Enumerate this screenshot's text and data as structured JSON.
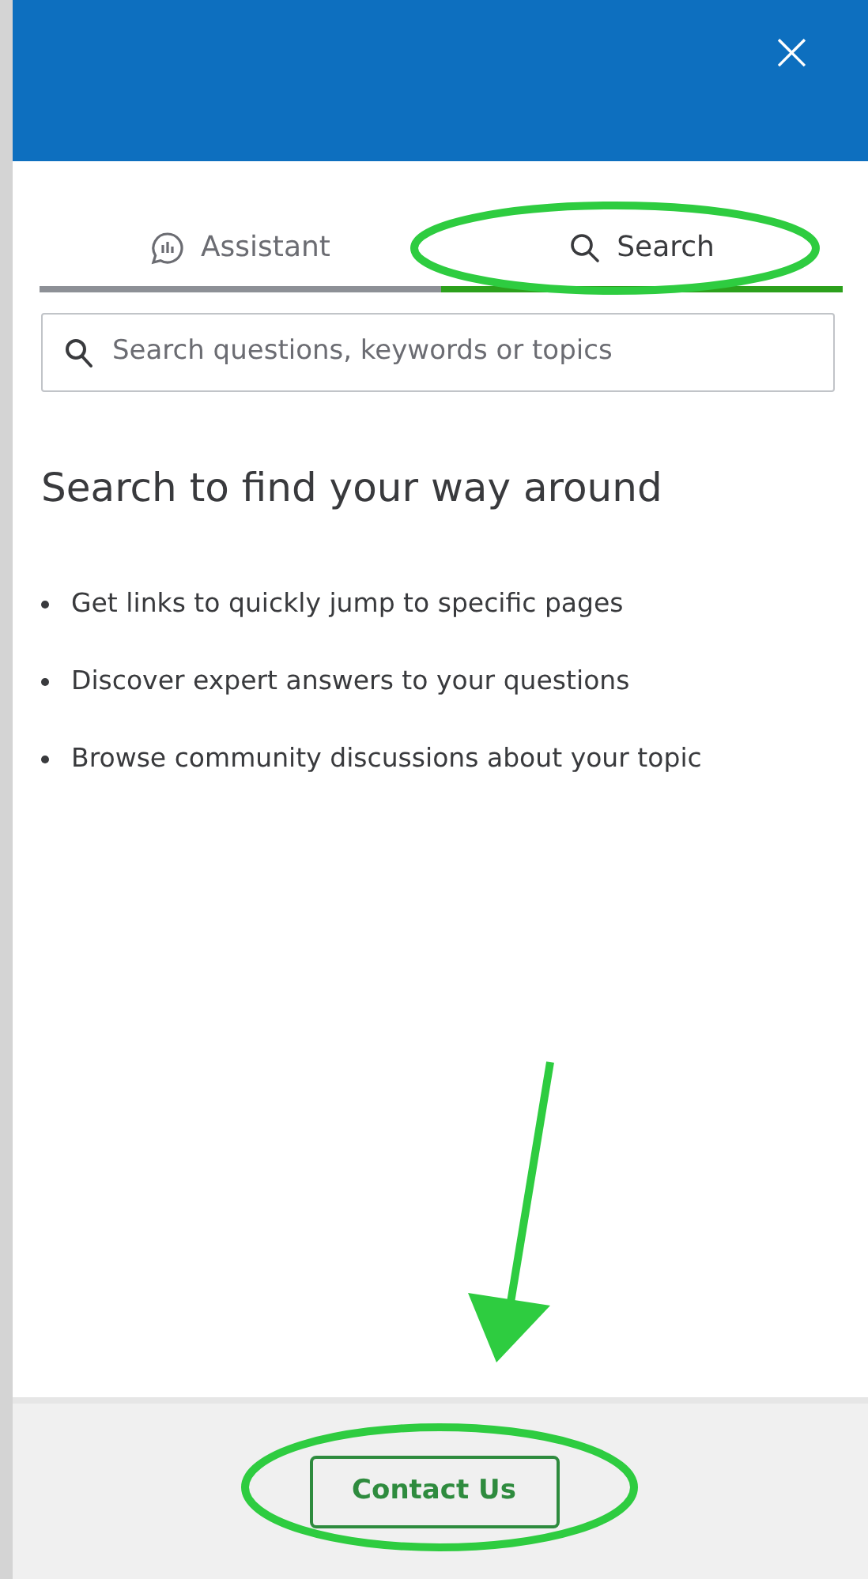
{
  "header": {
    "close": "×"
  },
  "tabs": [
    {
      "label": "Assistant",
      "kind": "chat",
      "selected": false
    },
    {
      "label": "Search",
      "kind": "search",
      "selected": true
    }
  ],
  "search": {
    "placeholder": "Search questions, keywords or topics"
  },
  "heading": "Search to find your way around",
  "bullets": [
    "Get links to quickly jump to specific pages",
    "Discover expert answers to your questions",
    "Browse community discussions about your topic"
  ],
  "footer": {
    "button": "Contact Us"
  },
  "annotations": [
    {
      "kind": "ellipse"
    },
    {
      "kind": "arrow"
    },
    {
      "kind": "ellipse"
    }
  ]
}
